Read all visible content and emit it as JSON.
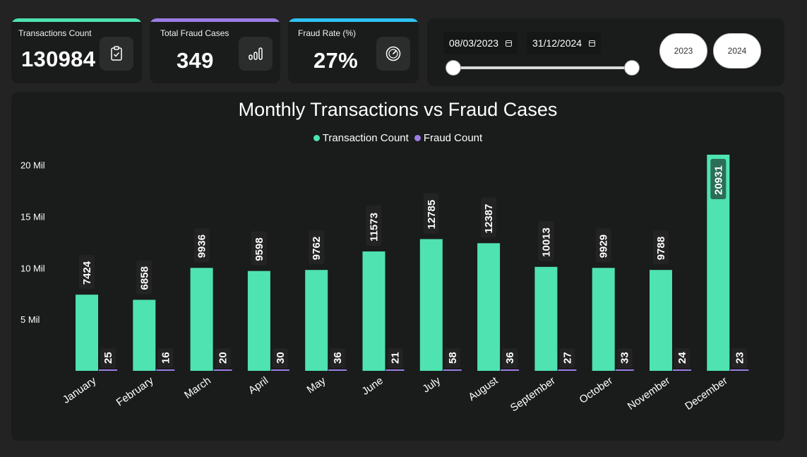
{
  "kpis": [
    {
      "label": "Transactions Count",
      "value": "130984",
      "accent": "#4ee3b1",
      "icon": "clipboard-check-icon"
    },
    {
      "label": "Total Fraud Cases",
      "value": "349",
      "accent": "#9b7ce6",
      "icon": "bar-chart-icon"
    },
    {
      "label": "Fraud Rate (%)",
      "value": "27%",
      "accent": "#2ec1f2",
      "icon": "speedometer-icon"
    }
  ],
  "date_filter": {
    "start": "08/03/2023",
    "end": "31/12/2024",
    "years": [
      "2023",
      "2024"
    ]
  },
  "chart_data": {
    "type": "bar",
    "title": "Monthly Transactions vs Fraud Cases",
    "categories": [
      "January",
      "February",
      "March",
      "April",
      "May",
      "June",
      "July",
      "August",
      "September",
      "October",
      "November",
      "December"
    ],
    "series": [
      {
        "name": "Transaction Count",
        "color": "#4ee3b1",
        "values": [
          7424,
          6858,
          9936,
          9598,
          9762,
          11573,
          12785,
          12387,
          10013,
          9929,
          9788,
          20931
        ],
        "axis_values_mil": [
          7.4,
          6.9,
          10.0,
          9.7,
          9.8,
          11.6,
          12.8,
          12.4,
          10.1,
          10.0,
          9.8,
          21.0
        ]
      },
      {
        "name": "Fraud Count",
        "color": "#9b7ce6",
        "values": [
          25,
          16,
          20,
          30,
          36,
          21,
          58,
          36,
          27,
          33,
          24,
          23
        ]
      }
    ],
    "y_ticks": [
      "5 Mil",
      "10 Mil",
      "15 Mil",
      "20 Mil"
    ],
    "y_tick_values": [
      5,
      10,
      15,
      20
    ],
    "ylim": [
      0,
      21
    ],
    "legend_position": "top-center",
    "grid": false
  }
}
